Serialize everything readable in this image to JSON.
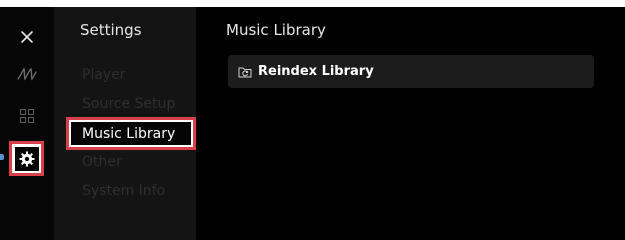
{
  "nav_rail": {
    "icons": [
      "close-icon",
      "signature-logo-icon",
      "grid-icon",
      "gear-icon"
    ],
    "active": "settings"
  },
  "settings_menu": {
    "title": "Settings",
    "items": [
      {
        "label": "Player",
        "selected": false
      },
      {
        "label": "Source Setup",
        "selected": false
      },
      {
        "label": "Music Library",
        "selected": true
      },
      {
        "label": "Other",
        "selected": false
      },
      {
        "label": "System Info",
        "selected": false
      }
    ]
  },
  "main": {
    "title": "Music Library",
    "actions": [
      {
        "label": "Reindex Library",
        "icon": "folder-refresh-icon"
      }
    ]
  },
  "colors": {
    "highlight_border": "#d8404a",
    "active_marker": "#5a8fd6",
    "background": "#000000",
    "menu_background": "#141414",
    "action_background": "#1c1c1c"
  }
}
